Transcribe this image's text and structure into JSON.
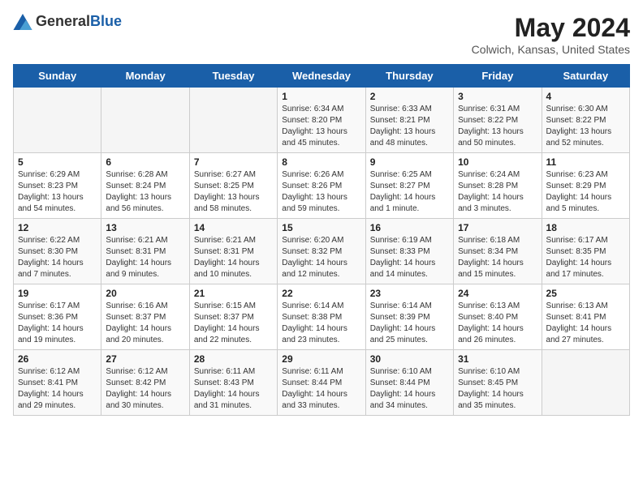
{
  "logo": {
    "general": "General",
    "blue": "Blue"
  },
  "title": "May 2024",
  "subtitle": "Colwich, Kansas, United States",
  "days_of_week": [
    "Sunday",
    "Monday",
    "Tuesday",
    "Wednesday",
    "Thursday",
    "Friday",
    "Saturday"
  ],
  "weeks": [
    [
      {
        "day": "",
        "info": ""
      },
      {
        "day": "",
        "info": ""
      },
      {
        "day": "",
        "info": ""
      },
      {
        "day": "1",
        "info": "Sunrise: 6:34 AM\nSunset: 8:20 PM\nDaylight: 13 hours and 45 minutes."
      },
      {
        "day": "2",
        "info": "Sunrise: 6:33 AM\nSunset: 8:21 PM\nDaylight: 13 hours and 48 minutes."
      },
      {
        "day": "3",
        "info": "Sunrise: 6:31 AM\nSunset: 8:22 PM\nDaylight: 13 hours and 50 minutes."
      },
      {
        "day": "4",
        "info": "Sunrise: 6:30 AM\nSunset: 8:22 PM\nDaylight: 13 hours and 52 minutes."
      }
    ],
    [
      {
        "day": "5",
        "info": "Sunrise: 6:29 AM\nSunset: 8:23 PM\nDaylight: 13 hours and 54 minutes."
      },
      {
        "day": "6",
        "info": "Sunrise: 6:28 AM\nSunset: 8:24 PM\nDaylight: 13 hours and 56 minutes."
      },
      {
        "day": "7",
        "info": "Sunrise: 6:27 AM\nSunset: 8:25 PM\nDaylight: 13 hours and 58 minutes."
      },
      {
        "day": "8",
        "info": "Sunrise: 6:26 AM\nSunset: 8:26 PM\nDaylight: 13 hours and 59 minutes."
      },
      {
        "day": "9",
        "info": "Sunrise: 6:25 AM\nSunset: 8:27 PM\nDaylight: 14 hours and 1 minute."
      },
      {
        "day": "10",
        "info": "Sunrise: 6:24 AM\nSunset: 8:28 PM\nDaylight: 14 hours and 3 minutes."
      },
      {
        "day": "11",
        "info": "Sunrise: 6:23 AM\nSunset: 8:29 PM\nDaylight: 14 hours and 5 minutes."
      }
    ],
    [
      {
        "day": "12",
        "info": "Sunrise: 6:22 AM\nSunset: 8:30 PM\nDaylight: 14 hours and 7 minutes."
      },
      {
        "day": "13",
        "info": "Sunrise: 6:21 AM\nSunset: 8:31 PM\nDaylight: 14 hours and 9 minutes."
      },
      {
        "day": "14",
        "info": "Sunrise: 6:21 AM\nSunset: 8:31 PM\nDaylight: 14 hours and 10 minutes."
      },
      {
        "day": "15",
        "info": "Sunrise: 6:20 AM\nSunset: 8:32 PM\nDaylight: 14 hours and 12 minutes."
      },
      {
        "day": "16",
        "info": "Sunrise: 6:19 AM\nSunset: 8:33 PM\nDaylight: 14 hours and 14 minutes."
      },
      {
        "day": "17",
        "info": "Sunrise: 6:18 AM\nSunset: 8:34 PM\nDaylight: 14 hours and 15 minutes."
      },
      {
        "day": "18",
        "info": "Sunrise: 6:17 AM\nSunset: 8:35 PM\nDaylight: 14 hours and 17 minutes."
      }
    ],
    [
      {
        "day": "19",
        "info": "Sunrise: 6:17 AM\nSunset: 8:36 PM\nDaylight: 14 hours and 19 minutes."
      },
      {
        "day": "20",
        "info": "Sunrise: 6:16 AM\nSunset: 8:37 PM\nDaylight: 14 hours and 20 minutes."
      },
      {
        "day": "21",
        "info": "Sunrise: 6:15 AM\nSunset: 8:37 PM\nDaylight: 14 hours and 22 minutes."
      },
      {
        "day": "22",
        "info": "Sunrise: 6:14 AM\nSunset: 8:38 PM\nDaylight: 14 hours and 23 minutes."
      },
      {
        "day": "23",
        "info": "Sunrise: 6:14 AM\nSunset: 8:39 PM\nDaylight: 14 hours and 25 minutes."
      },
      {
        "day": "24",
        "info": "Sunrise: 6:13 AM\nSunset: 8:40 PM\nDaylight: 14 hours and 26 minutes."
      },
      {
        "day": "25",
        "info": "Sunrise: 6:13 AM\nSunset: 8:41 PM\nDaylight: 14 hours and 27 minutes."
      }
    ],
    [
      {
        "day": "26",
        "info": "Sunrise: 6:12 AM\nSunset: 8:41 PM\nDaylight: 14 hours and 29 minutes."
      },
      {
        "day": "27",
        "info": "Sunrise: 6:12 AM\nSunset: 8:42 PM\nDaylight: 14 hours and 30 minutes."
      },
      {
        "day": "28",
        "info": "Sunrise: 6:11 AM\nSunset: 8:43 PM\nDaylight: 14 hours and 31 minutes."
      },
      {
        "day": "29",
        "info": "Sunrise: 6:11 AM\nSunset: 8:44 PM\nDaylight: 14 hours and 33 minutes."
      },
      {
        "day": "30",
        "info": "Sunrise: 6:10 AM\nSunset: 8:44 PM\nDaylight: 14 hours and 34 minutes."
      },
      {
        "day": "31",
        "info": "Sunrise: 6:10 AM\nSunset: 8:45 PM\nDaylight: 14 hours and 35 minutes."
      },
      {
        "day": "",
        "info": ""
      }
    ]
  ]
}
